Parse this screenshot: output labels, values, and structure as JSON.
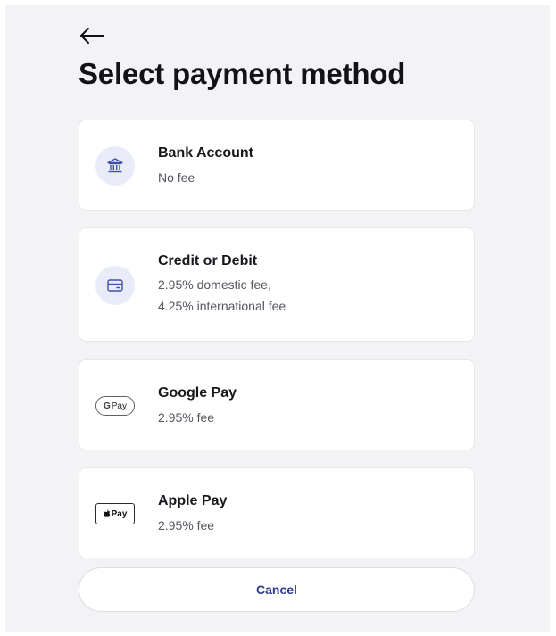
{
  "header": {
    "back_icon": "arrow-left-icon",
    "title": "Select payment method"
  },
  "methods": [
    {
      "name": "Bank Account",
      "fee_lines": [
        "No fee"
      ],
      "icon": "bank-icon"
    },
    {
      "name": "Credit or Debit",
      "fee_lines": [
        "2.95% domestic fee,",
        "4.25% international fee"
      ],
      "icon": "credit-card-icon"
    },
    {
      "name": "Google Pay",
      "fee_lines": [
        "2.95% fee"
      ],
      "icon": "google-pay-icon",
      "badge": {
        "g": "G",
        "text": "Pay"
      }
    },
    {
      "name": "Apple Pay",
      "fee_lines": [
        "2.95% fee"
      ],
      "icon": "apple-pay-icon",
      "badge": {
        "apple": "",
        "text": "Pay"
      }
    }
  ],
  "actions": {
    "cancel_label": "Cancel"
  },
  "colors": {
    "background": "#f3f3f5",
    "card": "#ffffff",
    "icon_circle": "#e9ecf8",
    "icon_accent": "#3f4fa8",
    "cancel_text": "#2e3a8c",
    "title_text": "#121217"
  }
}
